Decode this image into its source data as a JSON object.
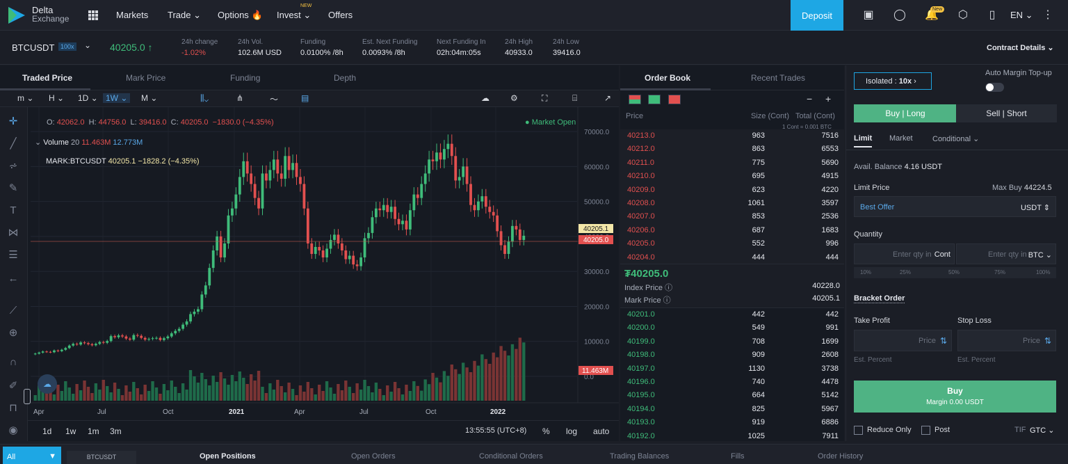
{
  "brand": {
    "line1": "Delta",
    "line2": "Exchange"
  },
  "nav": {
    "markets": "Markets",
    "trade": "Trade",
    "options": "Options",
    "invest": "Invest",
    "invest_badge": "NEW",
    "offers": "Offers"
  },
  "header": {
    "deposit": "Deposit",
    "new_badge": "New",
    "language": "EN"
  },
  "ticker": {
    "symbol": "BTCUSDT",
    "leverage_badge": "100x",
    "price": "40205.0",
    "stats": [
      {
        "label": "24h change",
        "value": "-1.02%"
      },
      {
        "label": "24h Vol.",
        "value": "102.6M USD"
      },
      {
        "label": "Funding",
        "value": "0.0100% /8h"
      },
      {
        "label": "Est. Next Funding",
        "value": "0.0093% /8h"
      },
      {
        "label": "Next Funding In",
        "value": "02h:04m:05s"
      },
      {
        "label": "24h High",
        "value": "40933.0"
      },
      {
        "label": "24h Low",
        "value": "39416.0"
      }
    ],
    "contract_details": "Contract Details"
  },
  "chart_tabs": [
    "Traded Price",
    "Mark Price",
    "Funding",
    "Depth"
  ],
  "chart_tools": {
    "m": "m",
    "h": "H",
    "d": "1D",
    "w": "1W",
    "mo": "M"
  },
  "ohlc": {
    "o_label": "O:",
    "o": "42062.0",
    "h_label": "H:",
    "h": "44756.0",
    "l_label": "L:",
    "l": "39416.0",
    "c_label": "C:",
    "c": "40205.0",
    "chg": "−1830.0 (−4.35%)"
  },
  "market_status": "Market Open",
  "volume_legend": {
    "label": "Volume",
    "n": "20",
    "v1": "11.463M",
    "v2": "12.773M"
  },
  "mark_legend": {
    "label": "MARK:BTCUSDT",
    "v": "40205.1",
    "chg": "−1828.2 (−4.35%)"
  },
  "chart_data": {
    "type": "candlestick",
    "y_ticks": [
      "70000.0",
      "60000.0",
      "50000.0",
      "40000.0",
      "30000.0",
      "20000.0",
      "10000.0",
      "0.0"
    ],
    "ylim": [
      0,
      73000
    ],
    "x_ticks": [
      "Apr",
      "Jul",
      "Oct",
      "2021",
      "Apr",
      "Jul",
      "Oct",
      "2022"
    ],
    "price_labels": [
      "40205.1",
      "40205.0"
    ],
    "volume_label": "11.463M",
    "closes": [
      6500,
      6800,
      7100,
      7000,
      6900,
      7400,
      7200,
      7600,
      8100,
      8800,
      9300,
      9100,
      9700,
      9500,
      9200,
      8900,
      9300,
      9800,
      9600,
      10100,
      11500,
      11200,
      11700,
      11400,
      10800,
      10500,
      11800,
      11600,
      11000,
      10500,
      10700,
      10900,
      11000,
      10400,
      10900,
      11400,
      12300,
      13000,
      13600,
      14800,
      15700,
      17800,
      18500,
      19200,
      23400,
      26000,
      31000,
      36000,
      40000,
      34000,
      38000,
      46000,
      48000,
      52000,
      57000,
      61500,
      58000,
      55000,
      51000,
      48000,
      58000,
      56000,
      59000,
      62000,
      58000,
      56500,
      63000,
      59000,
      61000,
      57000,
      55000,
      48000,
      38000,
      35000,
      37000,
      36000,
      34000,
      36500,
      39000,
      40500,
      38000,
      36000,
      33500,
      34500,
      32000,
      31500,
      34000,
      39500,
      41000,
      45500,
      48000,
      47500,
      49000,
      47000,
      48500,
      45000,
      43500,
      44500,
      42000,
      47500,
      52000,
      51000,
      55000,
      58000,
      62000,
      61500,
      64000,
      62000,
      65000,
      66500,
      63000,
      56000,
      57000,
      60000,
      55000,
      49000,
      47500,
      50000,
      51500,
      48500,
      47000,
      46000,
      41500,
      37500,
      35000,
      38500,
      43000,
      42000,
      39000,
      40205
    ]
  },
  "range": {
    "r1": "1d",
    "r2": "1w",
    "r3": "1m",
    "r4": "3m",
    "clock": "13:55:55 (UTC+8)",
    "pct": "%",
    "log": "log",
    "auto": "auto"
  },
  "orderbook": {
    "tabs": [
      "Order Book",
      "Recent Trades"
    ],
    "headers": {
      "price": "Price",
      "size": "Size (Cont)",
      "total": "Total (Cont)",
      "note": "1 Cont = 0.001 BTC"
    },
    "asks": [
      [
        "40213.0",
        "963",
        "7516"
      ],
      [
        "40212.0",
        "863",
        "6553"
      ],
      [
        "40211.0",
        "775",
        "5690"
      ],
      [
        "40210.0",
        "695",
        "4915"
      ],
      [
        "40209.0",
        "623",
        "4220"
      ],
      [
        "40208.0",
        "1061",
        "3597"
      ],
      [
        "40207.0",
        "853",
        "2536"
      ],
      [
        "40206.0",
        "687",
        "1683"
      ],
      [
        "40205.0",
        "552",
        "996"
      ],
      [
        "40204.0",
        "444",
        "444"
      ]
    ],
    "last": "₮40205.0",
    "index_label": "Index Price",
    "index_value": "40228.0",
    "mark_label": "Mark Price",
    "mark_value": "40205.1",
    "bids": [
      [
        "40201.0",
        "442",
        "442"
      ],
      [
        "40200.0",
        "549",
        "991"
      ],
      [
        "40199.0",
        "708",
        "1699"
      ],
      [
        "40198.0",
        "909",
        "2608"
      ],
      [
        "40197.0",
        "1130",
        "3738"
      ],
      [
        "40196.0",
        "740",
        "4478"
      ],
      [
        "40195.0",
        "664",
        "5142"
      ],
      [
        "40194.0",
        "825",
        "5967"
      ],
      [
        "40193.0",
        "919",
        "6886"
      ],
      [
        "40192.0",
        "1025",
        "7911"
      ]
    ]
  },
  "form": {
    "isolated": "Isolated",
    "iso_lev": "10x",
    "auto_margin": "Auto Margin Top-up",
    "buy_long": "Buy | Long",
    "sell_short": "Sell | Short",
    "order_types": [
      "Limit",
      "Market",
      "Conditional"
    ],
    "avail_label": "Avail. Balance",
    "avail_value": "4.16 USDT",
    "limit_price": "Limit Price",
    "max_buy_label": "Max Buy",
    "max_buy_value": "44224.5",
    "best_offer": "Best Offer",
    "usdt": "USDT",
    "quantity": "Quantity",
    "qty_ph1": "Enter qty in",
    "cont": "Cont",
    "qty_ph2": "Enter qty in",
    "btc": "BTC",
    "pcts": [
      "10%",
      "25%",
      "50%",
      "75%",
      "100%"
    ],
    "bracket": "Bracket Order",
    "take_profit": "Take Profit",
    "stop_loss": "Stop Loss",
    "price_ph": "Price",
    "est_percent": "Est. Percent",
    "buy": "Buy",
    "margin": "Margin 0.00 USDT",
    "reduce_only": "Reduce Only",
    "post": "Post",
    "tif": "TIF",
    "gtc": "GTC"
  },
  "bottom": {
    "all": "All",
    "symbol": "BTCUSDT",
    "tabs": [
      "Open Positions",
      "Open Orders",
      "Conditional Orders",
      "Trading Balances",
      "Fills",
      "Order History"
    ]
  }
}
